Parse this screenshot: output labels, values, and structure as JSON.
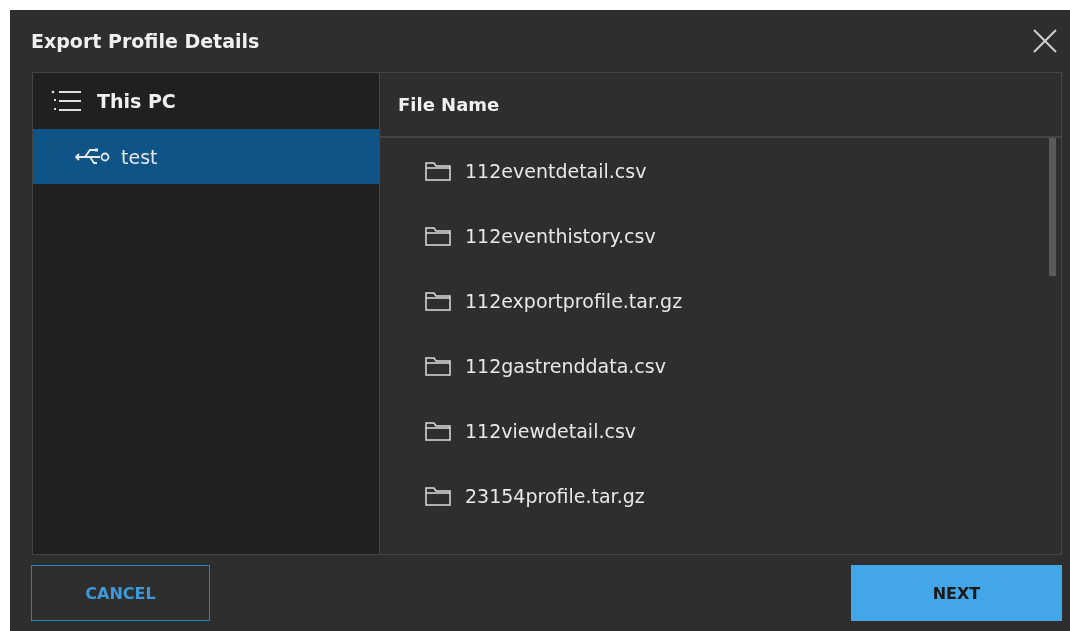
{
  "dialog": {
    "title": "Export Profile Details"
  },
  "tree": {
    "root": {
      "label": "This PC"
    },
    "items": [
      {
        "label": "test",
        "selected": true
      }
    ]
  },
  "file_list": {
    "column": "File Name",
    "files": [
      {
        "name": "112eventdetail.csv"
      },
      {
        "name": "112eventhistory.csv"
      },
      {
        "name": "112exportprofile.tar.gz"
      },
      {
        "name": "112gastrenddata.csv"
      },
      {
        "name": "112viewdetail.csv"
      },
      {
        "name": "23154profile.tar.gz"
      }
    ]
  },
  "buttons": [
    {
      "label": "CANCEL",
      "kind": "secondary"
    },
    {
      "label": "NEXT",
      "kind": "primary"
    }
  ]
}
